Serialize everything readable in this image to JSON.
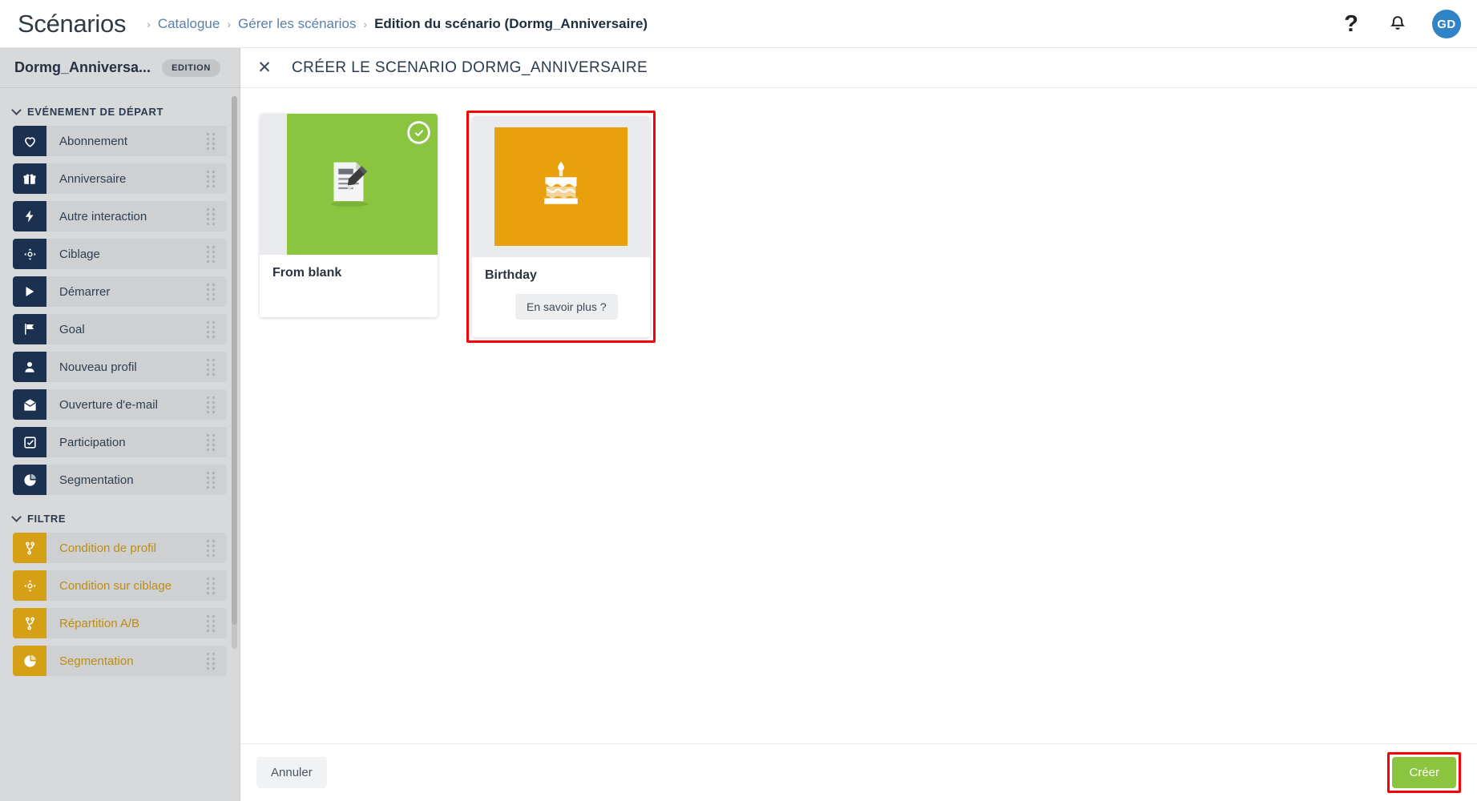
{
  "topbar": {
    "app_title": "Scénarios",
    "breadcrumb": [
      {
        "label": "Catalogue",
        "current": false
      },
      {
        "label": "Gérer les scénarios",
        "current": false
      },
      {
        "label": "Edition du scénario (Dormg_Anniversaire)",
        "current": true
      }
    ],
    "separator": "›",
    "help_icon": "help-icon",
    "help_glyph": "?",
    "notification_icon": "bell-icon",
    "avatar_initials": "GD",
    "avatar_color": "#3183c8"
  },
  "sidebar": {
    "scenario_name": "Dormg_Anniversa...",
    "status_badge": "EDITION",
    "groups": [
      {
        "title": "EVÉNEMENT DE DÉPART",
        "kind": "event",
        "items": [
          {
            "label": "Abonnement",
            "icon": "heart-icon"
          },
          {
            "label": "Anniversaire",
            "icon": "gift-icon"
          },
          {
            "label": "Autre interaction",
            "icon": "lightning-bolt-icon"
          },
          {
            "label": "Ciblage",
            "icon": "target-icon"
          },
          {
            "label": "Démarrer",
            "icon": "play-icon"
          },
          {
            "label": "Goal",
            "icon": "flag-icon"
          },
          {
            "label": "Nouveau profil",
            "icon": "user-icon"
          },
          {
            "label": "Ouverture d'e-mail",
            "icon": "envelope-open-icon"
          },
          {
            "label": "Participation",
            "icon": "checkbox-icon"
          },
          {
            "label": "Segmentation",
            "icon": "pie-chart-icon"
          }
        ]
      },
      {
        "title": "FILTRE",
        "kind": "filter",
        "items": [
          {
            "label": "Condition de profil",
            "icon": "branch-icon"
          },
          {
            "label": "Condition sur ciblage",
            "icon": "target-icon"
          },
          {
            "label": "Répartition A/B",
            "icon": "branch-icon"
          },
          {
            "label": "Segmentation",
            "icon": "pie-chart-icon"
          }
        ]
      }
    ],
    "colors": {
      "event_icon_bg": "#1c3150",
      "filter_icon_bg": "#d5a016",
      "filter_text": "#bc8d14"
    }
  },
  "main": {
    "close_icon": "close-icon",
    "title": "CRÉER LE SCENARIO DORMG_ANNIVERSAIRE",
    "cards": [
      {
        "title": "From blank",
        "thumb_icon": "document-pencil-icon",
        "thumb_color": "#8bc53f",
        "selected": true,
        "highlighted": false,
        "learn_more": null
      },
      {
        "title": "Birthday",
        "thumb_icon": "birthday-cake-icon",
        "thumb_color": "#e8a00c",
        "selected": false,
        "highlighted": true,
        "learn_more": "En savoir plus ?"
      }
    ]
  },
  "footer": {
    "cancel_label": "Annuler",
    "create_label": "Créer",
    "create_color": "#8bc53f",
    "highlight_color": "#fb0007"
  }
}
